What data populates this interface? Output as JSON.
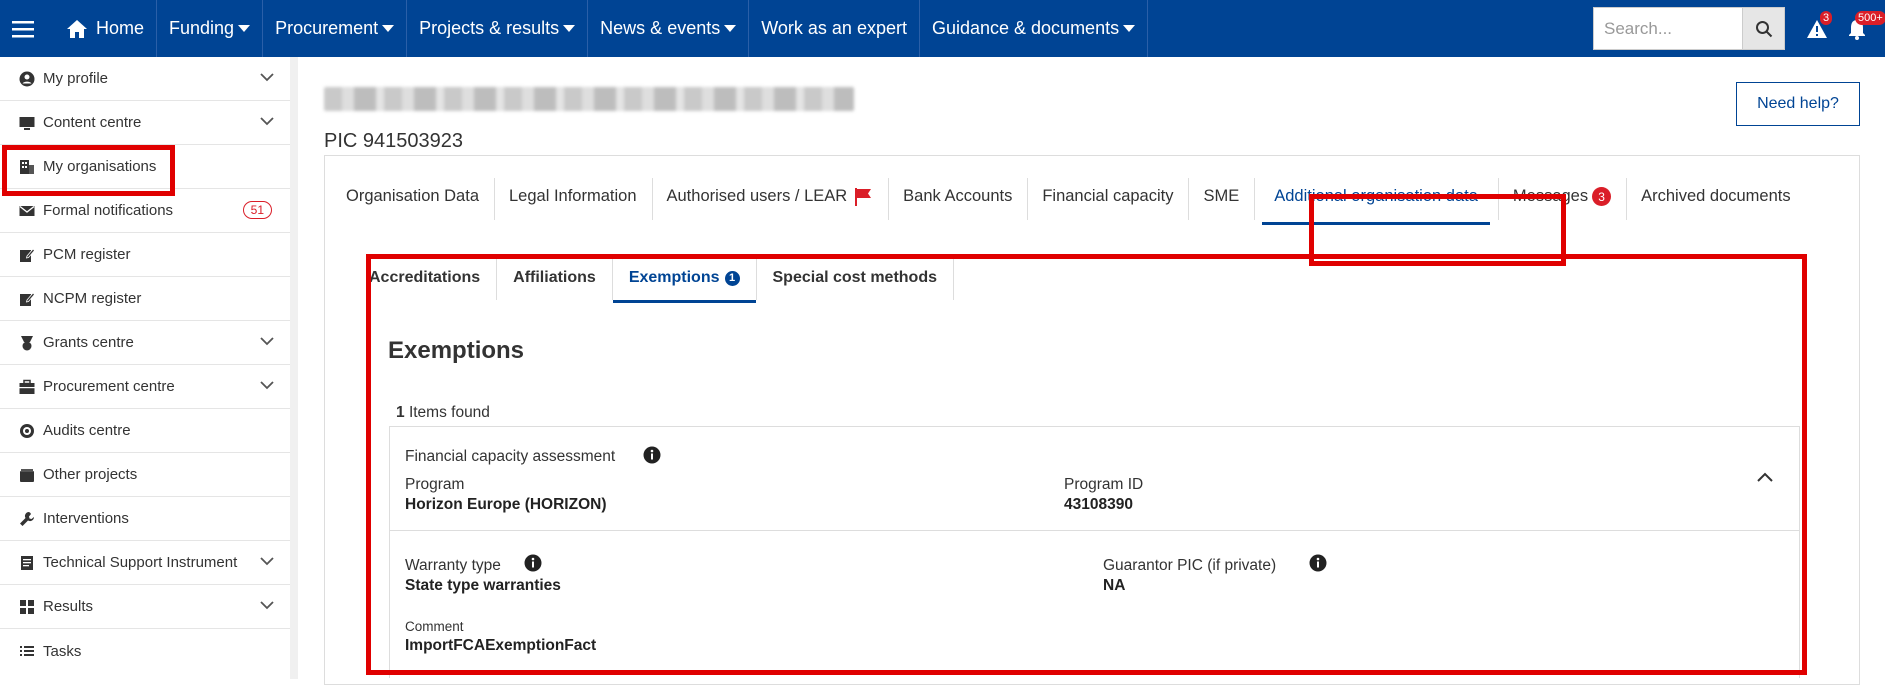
{
  "topnav": {
    "home": "Home",
    "items": [
      "Funding",
      "Procurement",
      "Projects & results",
      "News & events",
      "Work as an expert",
      "Guidance & documents"
    ],
    "search_placeholder": "Search...",
    "tasks_badge": "3",
    "notifications_badge": "500+"
  },
  "sidebar": {
    "items": [
      {
        "label": "My profile",
        "icon": "user-circle-icon"
      },
      {
        "label": "Content centre",
        "icon": "monitor-icon"
      },
      {
        "label": "My organisations",
        "icon": "building-icon"
      },
      {
        "label": "Formal notifications",
        "icon": "envelope-icon",
        "count": "51"
      },
      {
        "label": "PCM register",
        "icon": "edit-icon"
      },
      {
        "label": "NCPM register",
        "icon": "edit-icon"
      },
      {
        "label": "Grants centre",
        "icon": "medal-icon"
      },
      {
        "label": "Procurement centre",
        "icon": "briefcase-icon"
      },
      {
        "label": "Audits centre",
        "icon": "target-icon"
      },
      {
        "label": "Other projects",
        "icon": "box-icon"
      },
      {
        "label": "Interventions",
        "icon": "wrench-icon"
      },
      {
        "label": "Technical Support Instrument",
        "icon": "book-icon"
      },
      {
        "label": "Results",
        "icon": "grid-icon"
      },
      {
        "label": "Tasks",
        "icon": "list-icon"
      }
    ]
  },
  "main": {
    "pic": "PIC 941503923",
    "help_button": "Need help?",
    "tabs": [
      "Organisation Data",
      "Legal Information",
      "Authorised users / LEAR",
      "Bank Accounts",
      "Financial capacity",
      "SME",
      "Additional organisation data",
      "Messages",
      "Archived documents"
    ],
    "messages_count": "3",
    "subtabs": [
      "Accreditations",
      "Affiliations",
      "Exemptions",
      "Special cost methods"
    ],
    "exemptions_count": "1",
    "section_title": "Exemptions",
    "items_found_count": "1",
    "items_found_label": "Items found",
    "exemption": {
      "title": "Financial capacity assessment",
      "program_label": "Program",
      "program_value": "Horizon Europe (HORIZON)",
      "program_id_label": "Program ID",
      "program_id_value": "43108390",
      "warranty_label": "Warranty type",
      "warranty_value": "State type warranties",
      "guarantor_label": "Guarantor PIC (if private)",
      "guarantor_value": "NA",
      "comment_label": "Comment",
      "comment_value": "ImportFCAExemptionFact"
    }
  },
  "colors": {
    "brand": "#004494",
    "alert": "#da1e28",
    "highlight": "#e00000"
  }
}
